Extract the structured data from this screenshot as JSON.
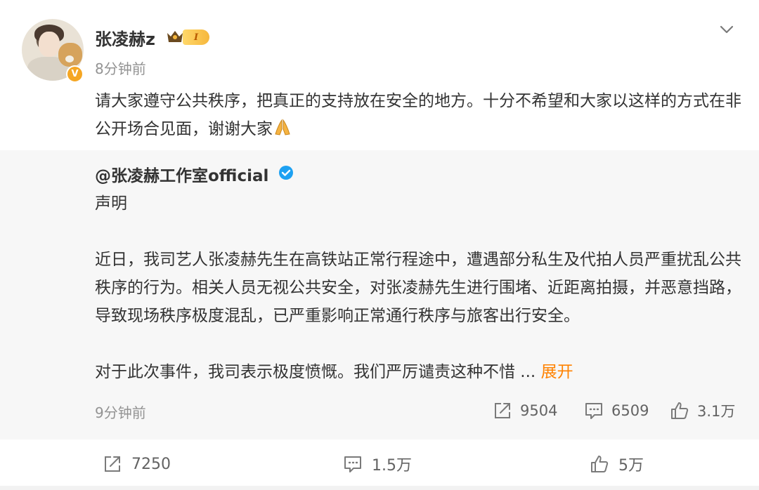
{
  "post": {
    "username": "张凌赫z",
    "level": "I",
    "verified_badge": "V",
    "time": "8分钟前",
    "text": "请大家遵守公共秩序，把真正的支持放在安全的地方。十分不希望和大家以这样的方式在非公开场合见面，谢谢大家"
  },
  "repost": {
    "author": "@张凌赫工作室official",
    "paragraphs": [
      "声明",
      "",
      "近日，我司艺人张凌赫先生在高铁站正常行程途中，遭遇部分私生及代拍人员严重扰乱公共秩序的行为。相关人员无视公共安全，对张凌赫先生进行围堵、近距离拍摄，并恶意挡路，导致现场秩序极度混乱，已严重影响正常通行秩序与旅客出行安全。",
      ""
    ],
    "last_line": "对于此次事件，我司表示极度愤慨。我们严厉谴责这种不惜",
    "ellipsis": " ... ",
    "expand_label": "展开",
    "time": "9分钟前",
    "reposts": "9504",
    "comments": "6509",
    "likes": "3.1万"
  },
  "footer": {
    "reposts": "7250",
    "comments": "1.5万",
    "likes": "5万"
  },
  "colors": {
    "accent": "#ff8200",
    "verified_blue": "#1da1f2",
    "gold": "#f5a623",
    "muted": "#939393",
    "repost_bg": "#f7f7f7"
  },
  "icons": [
    "chevron-down-icon",
    "crown-icon",
    "blue-verified-icon",
    "pray-emoji",
    "repost-icon",
    "comment-icon",
    "like-icon"
  ]
}
